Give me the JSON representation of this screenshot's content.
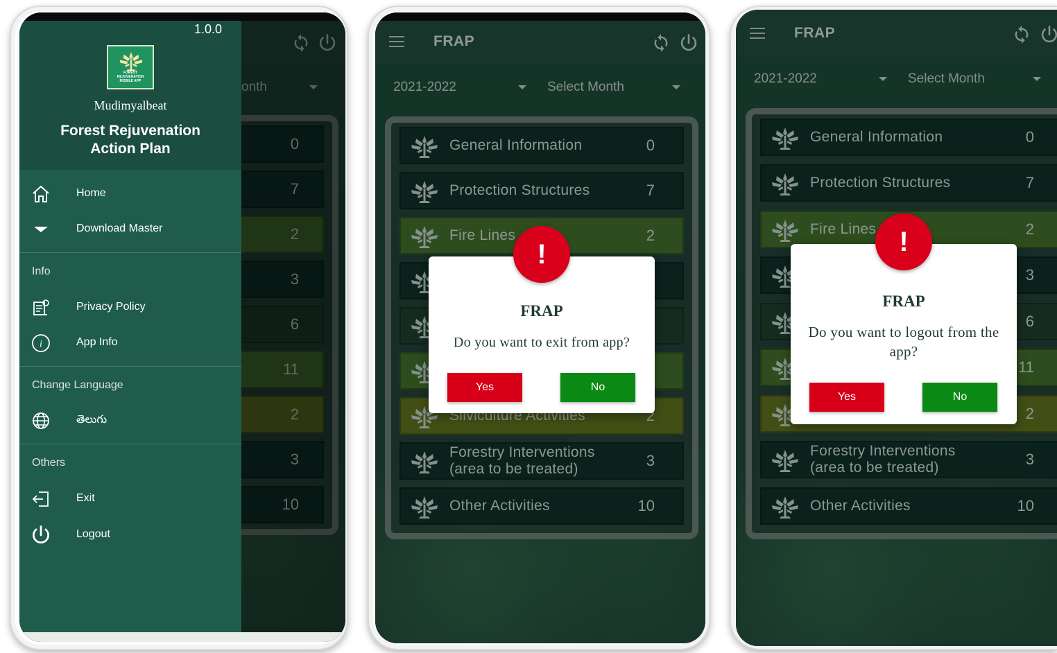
{
  "app": {
    "title": "FRAP",
    "version": "1.0.0",
    "beat_name": "Mudimyalbeat",
    "full_name_line1": "Forest Rejuvenation",
    "full_name_line2": "Action Plan",
    "logo_text": "FOREST REJUVENATION MOBILE APP"
  },
  "filters": {
    "year": "2021-2022",
    "month_placeholder": "Select Month",
    "month_partial": "onth"
  },
  "categories": [
    {
      "label": "General Information",
      "value": "0",
      "color": "#0f2f28"
    },
    {
      "label": "Protection Structures",
      "value": "7",
      "color": "#0f2f28"
    },
    {
      "label": "Fire Lines",
      "value": "2",
      "color": "#3f6b2a"
    },
    {
      "label": "",
      "value": "3",
      "color": "#0f2f28"
    },
    {
      "label": "",
      "value": "6",
      "color": "#1c3d2b"
    },
    {
      "label": "",
      "value": "11",
      "color": "#3f6b2a"
    },
    {
      "label": "Silviculture Activities",
      "value": "2",
      "color": "#5a6e1e"
    },
    {
      "label_line1": "Forestry Interventions",
      "label_line2": "(area to be treated)",
      "value": "3",
      "color": "#0f2f28"
    },
    {
      "label": "Other Activities",
      "value": "10",
      "color": "#0f2f28"
    }
  ],
  "drawer": {
    "home": "Home",
    "download_master": "Download Master",
    "info_section": "Info",
    "privacy_policy": "Privacy Policy",
    "app_info": "App Info",
    "language_section": "Change Language",
    "telugu": "తెలుగు",
    "others_section": "Others",
    "exit": "Exit",
    "logout": "Logout"
  },
  "exit_dialog": {
    "title": "FRAP",
    "message": "Do you want to exit from app?",
    "yes": "Yes",
    "no": "No"
  },
  "logout_dialog": {
    "title": "FRAP",
    "message": "Do you want to logout from the app?",
    "yes": "Yes",
    "no": "No"
  },
  "icons": {
    "badge": "!"
  },
  "colors": {
    "danger": "#d80018",
    "success": "#0a8a14",
    "drawer": "#1f5c4b"
  }
}
